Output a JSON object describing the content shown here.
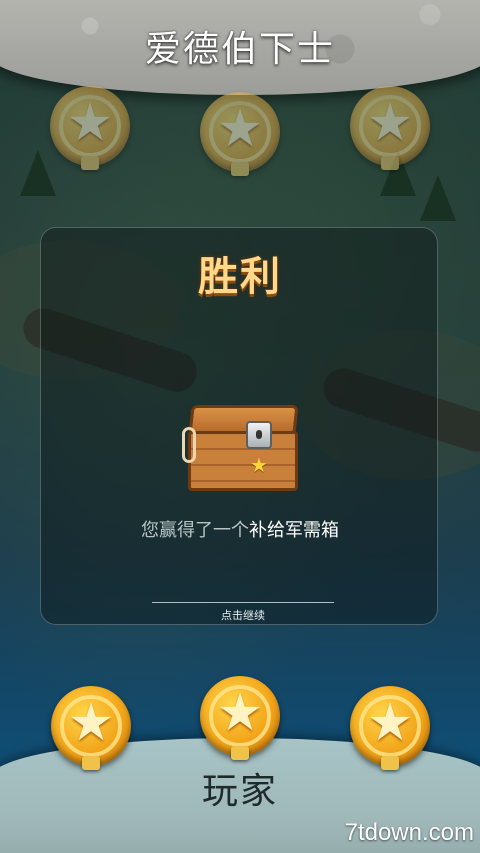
{
  "enemy": {
    "name": "爱德伯下士"
  },
  "player": {
    "name": "玩家"
  },
  "result": {
    "title": "胜利",
    "reward_prefix": "您赢得了一个",
    "reward_item": "补给军需箱",
    "continue_label": "点击继续"
  },
  "watermark": "7tdown.com",
  "icons": {
    "medal": "star-medal-icon",
    "crate": "supply-crate-icon"
  },
  "colors": {
    "victory_title": "#ffd88a",
    "medal_gold": "#f2a51a",
    "reward_text": "#b9c4c4"
  }
}
